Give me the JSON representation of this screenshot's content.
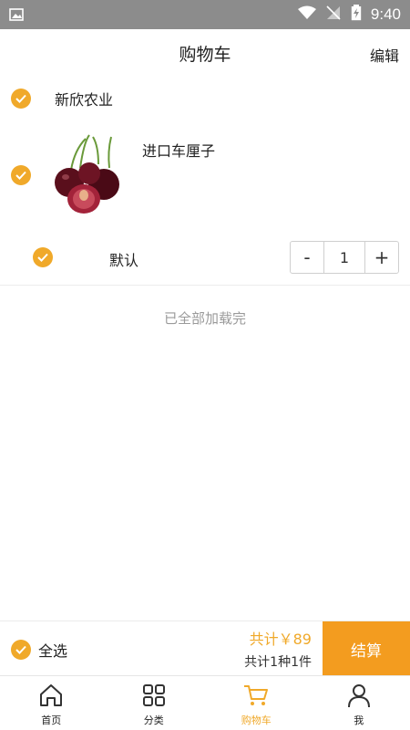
{
  "status_bar": {
    "time": "9:40"
  },
  "header": {
    "title": "购物车",
    "edit_label": "编辑"
  },
  "cart": {
    "shop_name": "新欣农业",
    "product": {
      "name": "进口车厘子",
      "spec": "默认",
      "quantity": "1"
    },
    "stepper": {
      "minus": "-",
      "plus": "+"
    },
    "loaded_text": "已全部加载完"
  },
  "checkout": {
    "select_all_label": "全选",
    "total_price": "共计￥89",
    "total_count": "共计1种1件",
    "checkout_label": "结算"
  },
  "tabs": [
    {
      "label": "首页",
      "icon": "home-icon"
    },
    {
      "label": "分类",
      "icon": "grid-icon"
    },
    {
      "label": "购物车",
      "icon": "cart-icon",
      "active": true
    },
    {
      "label": "我",
      "icon": "user-icon"
    }
  ],
  "colors": {
    "accent": "#f0a92a",
    "checkout_button": "#f39c1f"
  }
}
